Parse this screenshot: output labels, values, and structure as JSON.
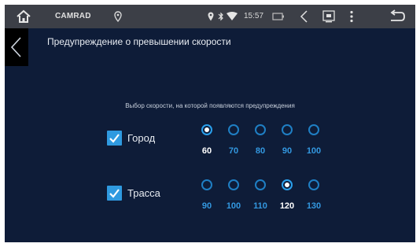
{
  "statusbar": {
    "app_name": "CAMRAD",
    "time": "15:57"
  },
  "header": {
    "title": "Предупреждение о превышении скорости"
  },
  "subtitle": "Выбор скорости, на которой появляются предупреждения",
  "rows": [
    {
      "label": "Город",
      "checked": true,
      "options": [
        "60",
        "70",
        "80",
        "90",
        "100"
      ],
      "selected_index": 0
    },
    {
      "label": "Трасса",
      "checked": true,
      "options": [
        "90",
        "100",
        "110",
        "120",
        "130"
      ],
      "selected_index": 3
    }
  ],
  "colors": {
    "background": "#0e1c38",
    "statusbar": "#3c3f47",
    "accent": "#2f9ae0"
  }
}
